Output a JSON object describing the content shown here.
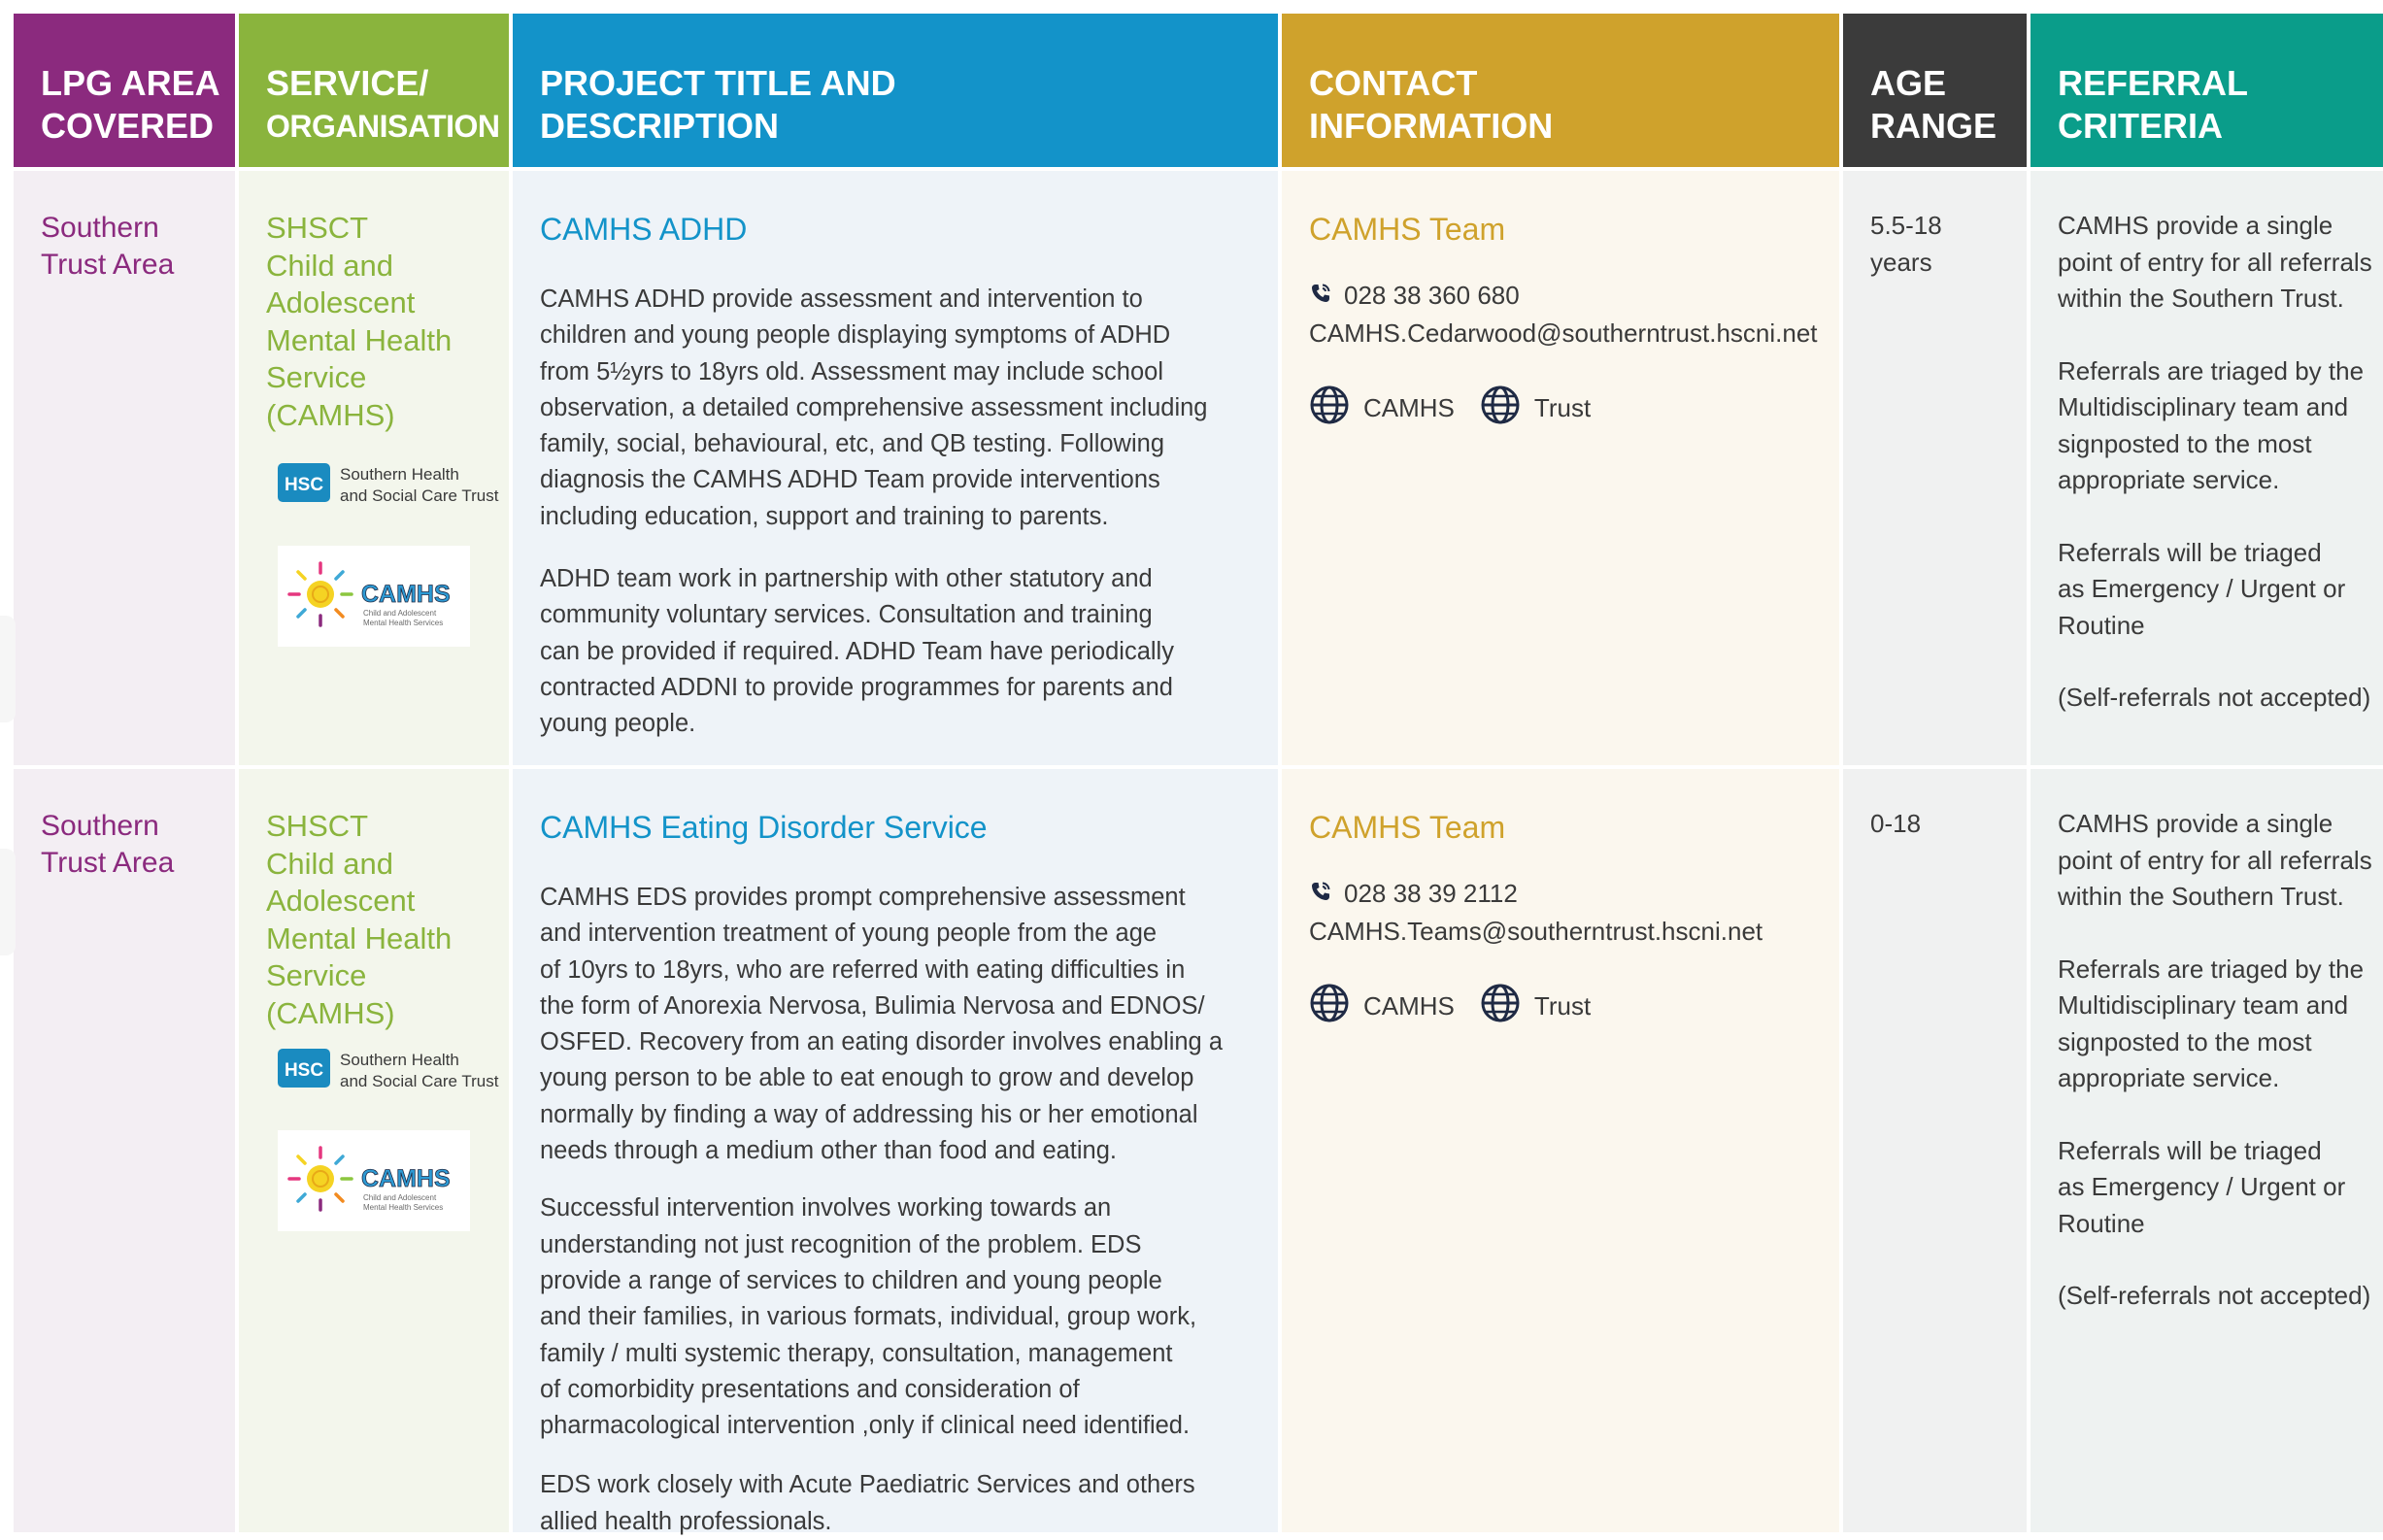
{
  "colors": {
    "lpg": "#8b2a7e",
    "service": "#8ab43d",
    "project": "#1393c9",
    "contact": "#cfa22c",
    "age": "#3b3b3b",
    "referral": "#0a9d8a"
  },
  "header": {
    "lpg": [
      "LPG AREA",
      "COVERED"
    ],
    "service": [
      "SERVICE/",
      "ORGANISATION"
    ],
    "project": [
      "PROJECT TITLE AND",
      "DESCRIPTION"
    ],
    "contact": [
      "CONTACT",
      "INFORMATION"
    ],
    "age": [
      "AGE",
      "RANGE"
    ],
    "referral": [
      "REFERRAL",
      "CRITERIA"
    ]
  },
  "rows": [
    {
      "lpg": [
        "Southern",
        "Trust Area"
      ],
      "service": [
        "SHSCT",
        "Child and",
        "Adolescent",
        "Mental Health",
        "Service",
        "(CAMHS)"
      ],
      "logos": {
        "hsc_mark": "HSC",
        "hsc_name": [
          "Southern Health",
          "and Social Care Trust"
        ],
        "camhs_mark": "CAMHS",
        "camhs_sub": [
          "Child and Adolescent",
          "Mental Health Services"
        ]
      },
      "project_title": "CAMHS ADHD",
      "paragraphs": [
        [
          "CAMHS ADHD provide assessment and intervention to",
          "children and young people displaying symptoms of ADHD",
          "from 5½yrs to 18yrs old. Assessment may include school",
          "observation, a detailed comprehensive assessment including",
          "family, social, behavioural, etc, and QB testing. Following",
          "diagnosis the CAMHS ADHD Team provide interventions",
          "including education, support and training to parents."
        ],
        [
          "ADHD team work in partnership with other statutory and",
          "community voluntary services. Consultation and training",
          "can be provided if required. ADHD Team have periodically",
          "contracted ADDNI to provide programmes for parents and",
          "young people."
        ]
      ],
      "contact_title": "CAMHS Team",
      "phone": "028 38 360 680",
      "email": "CAMHS.Cedarwood@southerntrust.hscni.net",
      "web": [
        "CAMHS",
        "Trust"
      ],
      "icons": [
        "phone-icon",
        "globe-icon"
      ],
      "age": [
        "5.5-18",
        "years"
      ],
      "referral": [
        [
          "CAMHS provide a single",
          "point of entry for all referrals",
          "within the Southern Trust."
        ],
        [
          "Referrals are triaged by the",
          "Multidisciplinary team and",
          "signposted to the most",
          "appropriate service."
        ],
        [
          "Referrals will be triaged",
          "as  Emergency / Urgent or",
          "Routine"
        ],
        [
          "(Self-referrals not accepted)"
        ]
      ]
    },
    {
      "lpg": [
        "Southern",
        "Trust Area"
      ],
      "service": [
        "SHSCT",
        "Child and",
        "Adolescent",
        "Mental Health",
        "Service",
        "(CAMHS)"
      ],
      "logos": {
        "hsc_mark": "HSC",
        "hsc_name": [
          "Southern Health",
          "and Social Care Trust"
        ],
        "camhs_mark": "CAMHS",
        "camhs_sub": [
          "Child and Adolescent",
          "Mental Health Services"
        ]
      },
      "project_title": "CAMHS Eating Disorder Service",
      "paragraphs": [
        [
          "CAMHS EDS provides prompt comprehensive assessment",
          "and intervention treatment of young people from the age",
          "of 10yrs to 18yrs, who are referred with eating difficulties in",
          "the form of Anorexia Nervosa, Bulimia Nervosa and EDNOS/",
          "OSFED. Recovery from an eating disorder involves enabling a",
          "young person to be able to eat enough to grow and develop",
          "normally by finding a way of addressing his or her emotional",
          "needs through a medium other than food and eating."
        ],
        [
          "Successful intervention involves working towards an",
          "understanding not just recognition of the problem. EDS",
          "provide a range of services to children and young people",
          "and their families, in various formats, individual, group work,",
          "family / multi systemic therapy, consultation, management",
          "of comorbidity presentations and consideration of",
          "pharmacological intervention ,only if clinical need identified."
        ],
        [
          "EDS work closely with Acute Paediatric Services and others",
          "allied health professionals."
        ]
      ],
      "contact_title": "CAMHS Team",
      "phone": "028 38 39 2112",
      "email": "CAMHS.Teams@southerntrust.hscni.net",
      "web": [
        "CAMHS",
        "Trust"
      ],
      "icons": [
        "phone-icon",
        "globe-icon"
      ],
      "age": [
        "0-18"
      ],
      "referral": [
        [
          "CAMHS provide a single",
          "point of entry for all referrals",
          "within the Southern Trust."
        ],
        [
          "Referrals are triaged by the",
          "Multidisciplinary team and",
          "signposted to the most",
          "appropriate service."
        ],
        [
          "Referrals will be triaged",
          "as  Emergency / Urgent or",
          "Routine"
        ],
        [
          "(Self-referrals not accepted)"
        ]
      ]
    }
  ]
}
